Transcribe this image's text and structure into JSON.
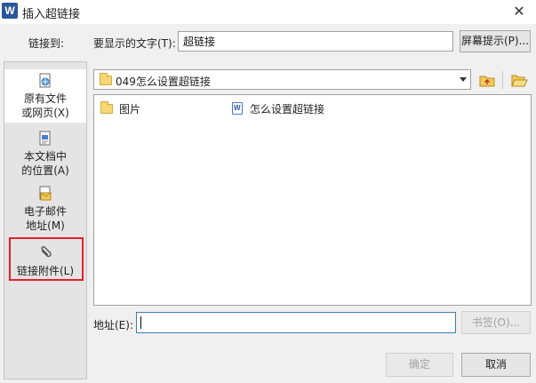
{
  "window": {
    "title": "插入超链接",
    "app_icon_letter": "W"
  },
  "display_text": {
    "label": "要显示的文字(T):",
    "value": "超链接",
    "screen_tip_button": "屏幕提示(P)..."
  },
  "link_to": {
    "label": "链接到:",
    "items": [
      {
        "line1": "原有文件",
        "line2": "或网页(X)",
        "icon": "file-web-icon"
      },
      {
        "line1": "本文档中",
        "line2": "的位置(A)",
        "icon": "document-place-icon"
      },
      {
        "line1": "电子邮件",
        "line2": "地址(M)",
        "icon": "email-icon"
      },
      {
        "line1": "链接附件(L)",
        "line2": "",
        "icon": "paperclip-icon"
      }
    ]
  },
  "folder": {
    "current": "049怎么设置超链接",
    "up_icon": "folder-up-icon",
    "open_icon": "folder-open-icon"
  },
  "files": [
    {
      "name": "图片",
      "type": "folder"
    },
    {
      "name": "怎么设置超链接",
      "type": "word-doc"
    }
  ],
  "address": {
    "label": "地址(E):",
    "value": "",
    "bookmark_button": "书签(O)..."
  },
  "buttons": {
    "ok": "确定",
    "cancel": "取消"
  },
  "colors": {
    "highlight": "#e0222a",
    "app_icon": "#2b579a",
    "address_focus": "#3c7fb1"
  }
}
